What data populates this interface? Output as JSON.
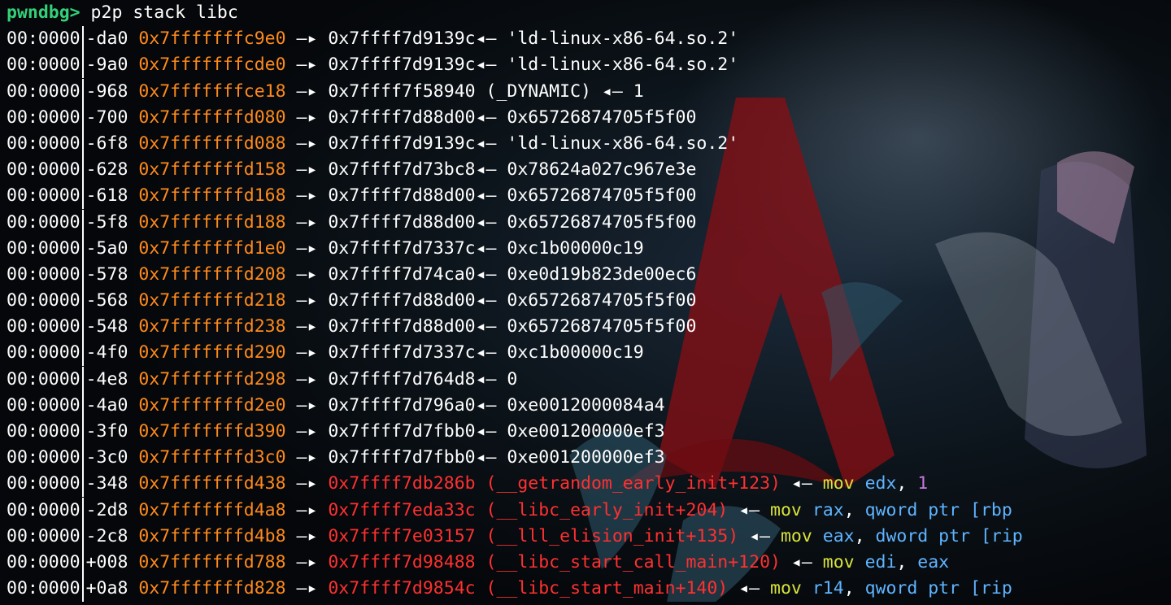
{
  "prompt": {
    "label": "pwndbg>",
    "command": " p2p stack libc"
  },
  "colors": {
    "prompt": "#33d17a",
    "address": "#ff8a1c",
    "code_pointer": "#ff3030",
    "mnemonic": "#d8e23a",
    "register": "#5fb4ff",
    "immediate": "#c678dd"
  },
  "rows": [
    {
      "idx": "00:0000",
      "off": "-da0",
      "addr": "0x7fffffffc9e0",
      "arrow1": "—▸",
      "tgt": "0x7ffff7d9139c",
      "sym": "",
      "arrow2": "◂—",
      "val": "'ld-linux-x86-64.so.2'",
      "mn": "",
      "op1": "",
      "sep": "",
      "op2": ""
    },
    {
      "idx": "00:0000",
      "off": "-9a0",
      "addr": "0x7fffffffcde0",
      "arrow1": "—▸",
      "tgt": "0x7ffff7d9139c",
      "sym": "",
      "arrow2": "◂—",
      "val": "'ld-linux-x86-64.so.2'",
      "mn": "",
      "op1": "",
      "sep": "",
      "op2": ""
    },
    {
      "idx": "00:0000",
      "off": "-968",
      "addr": "0x7fffffffce18",
      "arrow1": "—▸",
      "tgt": "0x7ffff7f58940",
      "sym": " (_DYNAMIC)",
      "arrow2": "◂—",
      "val": "1",
      "mn": "",
      "op1": "",
      "sep": "",
      "op2": ""
    },
    {
      "idx": "00:0000",
      "off": "-700",
      "addr": "0x7fffffffd080",
      "arrow1": "—▸",
      "tgt": "0x7ffff7d88d00",
      "sym": "",
      "arrow2": "◂—",
      "val": "0x65726874705f5f00",
      "mn": "",
      "op1": "",
      "sep": "",
      "op2": ""
    },
    {
      "idx": "00:0000",
      "off": "-6f8",
      "addr": "0x7fffffffd088",
      "arrow1": "—▸",
      "tgt": "0x7ffff7d9139c",
      "sym": "",
      "arrow2": "◂—",
      "val": "'ld-linux-x86-64.so.2'",
      "mn": "",
      "op1": "",
      "sep": "",
      "op2": ""
    },
    {
      "idx": "00:0000",
      "off": "-628",
      "addr": "0x7fffffffd158",
      "arrow1": "—▸",
      "tgt": "0x7ffff7d73bc8",
      "sym": "",
      "arrow2": "◂—",
      "val": "0x78624a027c967e3e",
      "mn": "",
      "op1": "",
      "sep": "",
      "op2": ""
    },
    {
      "idx": "00:0000",
      "off": "-618",
      "addr": "0x7fffffffd168",
      "arrow1": "—▸",
      "tgt": "0x7ffff7d88d00",
      "sym": "",
      "arrow2": "◂—",
      "val": "0x65726874705f5f00",
      "mn": "",
      "op1": "",
      "sep": "",
      "op2": ""
    },
    {
      "idx": "00:0000",
      "off": "-5f8",
      "addr": "0x7fffffffd188",
      "arrow1": "—▸",
      "tgt": "0x7ffff7d88d00",
      "sym": "",
      "arrow2": "◂—",
      "val": "0x65726874705f5f00",
      "mn": "",
      "op1": "",
      "sep": "",
      "op2": ""
    },
    {
      "idx": "00:0000",
      "off": "-5a0",
      "addr": "0x7fffffffd1e0",
      "arrow1": "—▸",
      "tgt": "0x7ffff7d7337c",
      "sym": "",
      "arrow2": "◂—",
      "val": "0xc1b00000c19",
      "mn": "",
      "op1": "",
      "sep": "",
      "op2": ""
    },
    {
      "idx": "00:0000",
      "off": "-578",
      "addr": "0x7fffffffd208",
      "arrow1": "—▸",
      "tgt": "0x7ffff7d74ca0",
      "sym": "",
      "arrow2": "◂—",
      "val": "0xe0d19b823de00ec6",
      "mn": "",
      "op1": "",
      "sep": "",
      "op2": ""
    },
    {
      "idx": "00:0000",
      "off": "-568",
      "addr": "0x7fffffffd218",
      "arrow1": "—▸",
      "tgt": "0x7ffff7d88d00",
      "sym": "",
      "arrow2": "◂—",
      "val": "0x65726874705f5f00",
      "mn": "",
      "op1": "",
      "sep": "",
      "op2": ""
    },
    {
      "idx": "00:0000",
      "off": "-548",
      "addr": "0x7fffffffd238",
      "arrow1": "—▸",
      "tgt": "0x7ffff7d88d00",
      "sym": "",
      "arrow2": "◂—",
      "val": "0x65726874705f5f00",
      "mn": "",
      "op1": "",
      "sep": "",
      "op2": ""
    },
    {
      "idx": "00:0000",
      "off": "-4f0",
      "addr": "0x7fffffffd290",
      "arrow1": "—▸",
      "tgt": "0x7ffff7d7337c",
      "sym": "",
      "arrow2": "◂—",
      "val": "0xc1b00000c19",
      "mn": "",
      "op1": "",
      "sep": "",
      "op2": ""
    },
    {
      "idx": "00:0000",
      "off": "-4e8",
      "addr": "0x7fffffffd298",
      "arrow1": "—▸",
      "tgt": "0x7ffff7d764d8",
      "sym": "",
      "arrow2": "◂—",
      "val": "0",
      "mn": "",
      "op1": "",
      "sep": "",
      "op2": ""
    },
    {
      "idx": "00:0000",
      "off": "-4a0",
      "addr": "0x7fffffffd2e0",
      "arrow1": "—▸",
      "tgt": "0x7ffff7d796a0",
      "sym": "",
      "arrow2": "◂—",
      "val": "0xe0012000084a4",
      "mn": "",
      "op1": "",
      "sep": "",
      "op2": ""
    },
    {
      "idx": "00:0000",
      "off": "-3f0",
      "addr": "0x7fffffffd390",
      "arrow1": "—▸",
      "tgt": "0x7ffff7d7fbb0",
      "sym": "",
      "arrow2": "◂—",
      "val": "0xe001200000ef3",
      "mn": "",
      "op1": "",
      "sep": "",
      "op2": ""
    },
    {
      "idx": "00:0000",
      "off": "-3c0",
      "addr": "0x7fffffffd3c0",
      "arrow1": "—▸",
      "tgt": "0x7ffff7d7fbb0",
      "sym": "",
      "arrow2": "◂—",
      "val": "0xe001200000ef3",
      "mn": "",
      "op1": "",
      "sep": "",
      "op2": ""
    },
    {
      "idx": "00:0000",
      "off": "-348",
      "addr": "0x7fffffffd438",
      "arrow1": "—▸",
      "tgt": "0x7ffff7db286b",
      "sym": " (__getrandom_early_init+123)",
      "arrow2": "◂—",
      "val": "",
      "mn": "mov",
      "op1": "edx",
      "sep": ", ",
      "op2": "1"
    },
    {
      "idx": "00:0000",
      "off": "-2d8",
      "addr": "0x7fffffffd4a8",
      "arrow1": "—▸",
      "tgt": "0x7ffff7eda33c",
      "sym": " (__libc_early_init+204)",
      "arrow2": "◂—",
      "val": "",
      "mn": "mov",
      "op1": "rax",
      "sep": ", ",
      "op2": "qword ptr [rbp"
    },
    {
      "idx": "00:0000",
      "off": "-2c8",
      "addr": "0x7fffffffd4b8",
      "arrow1": "—▸",
      "tgt": "0x7ffff7e03157",
      "sym": " (__lll_elision_init+135)",
      "arrow2": "◂—",
      "val": "",
      "mn": "mov",
      "op1": "eax",
      "sep": ", ",
      "op2": "dword ptr [rip"
    },
    {
      "idx": "00:0000",
      "off": "+008",
      "addr": "0x7fffffffd788",
      "arrow1": "—▸",
      "tgt": "0x7ffff7d98488",
      "sym": " (__libc_start_call_main+120)",
      "arrow2": "◂—",
      "val": "",
      "mn": "mov",
      "op1": "edi",
      "sep": ", ",
      "op2": "eax"
    },
    {
      "idx": "00:0000",
      "off": "+0a8",
      "addr": "0x7fffffffd828",
      "arrow1": "—▸",
      "tgt": "0x7ffff7d9854c",
      "sym": " (__libc_start_main+140)",
      "arrow2": "◂—",
      "val": "",
      "mn": "mov",
      "op1": "r14",
      "sep": ", ",
      "op2": "qword ptr [rip"
    }
  ]
}
